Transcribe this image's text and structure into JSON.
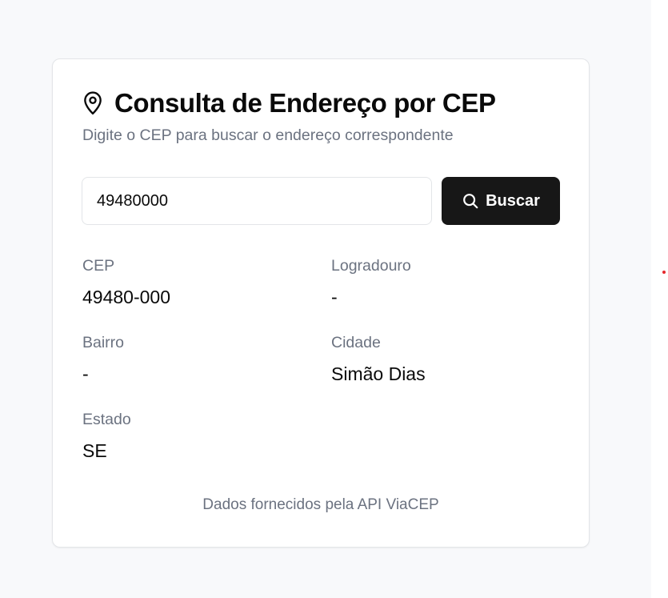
{
  "header": {
    "title": "Consulta de Endereço por CEP",
    "subtitle": "Digite o CEP para buscar o endereço correspondente",
    "icon": "map-pin-icon"
  },
  "search": {
    "value": "49480000",
    "button_label": "Buscar",
    "button_icon": "search-icon"
  },
  "result": {
    "cep": {
      "label": "CEP",
      "value": "49480-000"
    },
    "logradouro": {
      "label": "Logradouro",
      "value": "-"
    },
    "bairro": {
      "label": "Bairro",
      "value": "-"
    },
    "cidade": {
      "label": "Cidade",
      "value": "Simão Dias"
    },
    "estado": {
      "label": "Estado",
      "value": "SE"
    }
  },
  "footer": {
    "text": "Dados fornecidos pela API ViaCEP"
  },
  "colors": {
    "background": "#f8f9fb",
    "card": "#ffffff",
    "button": "#171717",
    "muted_text": "#6b7280",
    "text": "#0a0a0a"
  }
}
